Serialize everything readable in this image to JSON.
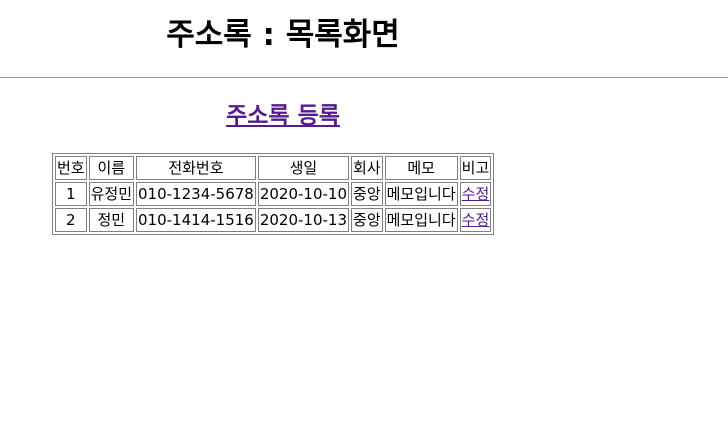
{
  "header": {
    "title": "주소록 : 목록화면"
  },
  "register_link": "주소록 등록",
  "table": {
    "columns": [
      "번호",
      "이름",
      "전화번호",
      "생일",
      "회사",
      "메모",
      "비고"
    ],
    "rows": [
      {
        "no": "1",
        "name": "유정민",
        "phone": "010-1234-5678",
        "birthday": "2020-10-10",
        "company": "중앙",
        "memo": "메모입니다",
        "action": "수정"
      },
      {
        "no": "2",
        "name": "정민",
        "phone": "010-1414-1516",
        "birthday": "2020-10-13",
        "company": "중앙",
        "memo": "메모입니다",
        "action": "수정"
      }
    ]
  },
  "colors": {
    "visited_link": "#551a8b",
    "border": "#808080",
    "divider": "#9a9a9a"
  }
}
